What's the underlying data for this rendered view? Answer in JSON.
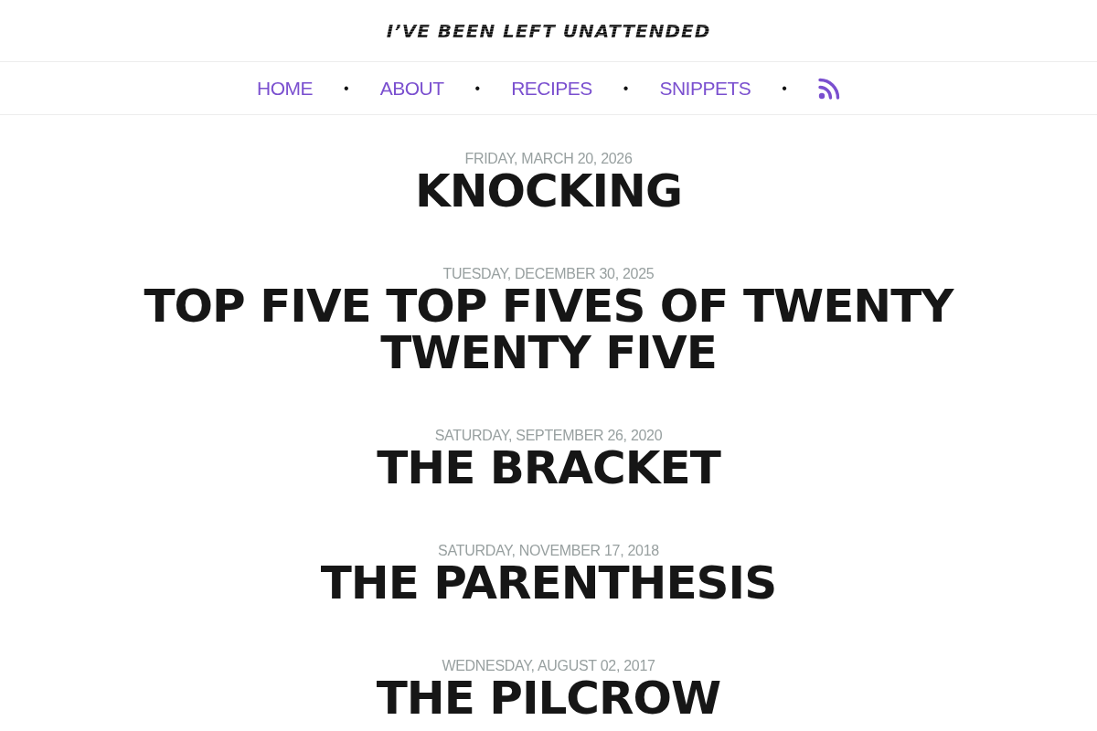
{
  "site": {
    "title": "I’VE BEEN LEFT UNATTENDED"
  },
  "nav": {
    "items": [
      {
        "label": "HOME",
        "kind": "link"
      },
      {
        "label": "ABOUT",
        "kind": "link"
      },
      {
        "label": "RECIPES",
        "kind": "link"
      },
      {
        "label": "SNIPPETS",
        "kind": "link"
      },
      {
        "kind": "rss"
      }
    ],
    "separator": "•"
  },
  "posts": [
    {
      "date": "FRIDAY, MARCH 20, 2026",
      "title": "KNOCKING"
    },
    {
      "date": "TUESDAY, DECEMBER 30, 2025",
      "title": "TOP FIVE TOP FIVES OF TWENTY TWENTY FIVE"
    },
    {
      "date": "SATURDAY, SEPTEMBER 26, 2020",
      "title": "THE BRACKET"
    },
    {
      "date": "SATURDAY, NOVEMBER 17, 2018",
      "title": "THE PARENTHESIS"
    },
    {
      "date": "WEDNESDAY, AUGUST 02, 2017",
      "title": "THE PILCROW"
    }
  ]
}
